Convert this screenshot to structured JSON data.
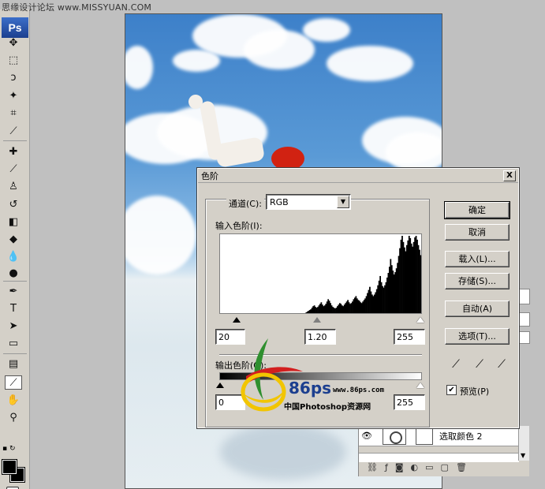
{
  "watermark": "思缘设计论坛 www.MISSYUAN.COM",
  "app": {
    "logo": "Ps"
  },
  "tools": [
    {
      "name": "move-tool-icon",
      "glyph": "✥"
    },
    {
      "name": "marquee-tool-icon",
      "glyph": "⬚"
    },
    {
      "name": "lasso-tool-icon",
      "glyph": "ↄ"
    },
    {
      "name": "magic-wand-tool-icon",
      "glyph": "✦"
    },
    {
      "name": "crop-tool-icon",
      "glyph": "⌗"
    },
    {
      "name": "slice-tool-icon",
      "glyph": "⟋"
    },
    {
      "name": "healing-brush-tool-icon",
      "glyph": "✚"
    },
    {
      "name": "brush-tool-icon",
      "glyph": "⟋"
    },
    {
      "name": "clone-stamp-tool-icon",
      "glyph": "♙"
    },
    {
      "name": "history-brush-tool-icon",
      "glyph": "↺"
    },
    {
      "name": "eraser-tool-icon",
      "glyph": "◧"
    },
    {
      "name": "paint-bucket-tool-icon",
      "glyph": "◆"
    },
    {
      "name": "blur-tool-icon",
      "glyph": "💧"
    },
    {
      "name": "dodge-tool-icon",
      "glyph": "●"
    },
    {
      "name": "pen-tool-icon",
      "glyph": "✒"
    },
    {
      "name": "type-tool-icon",
      "glyph": "T"
    },
    {
      "name": "path-selection-tool-icon",
      "glyph": "➤"
    },
    {
      "name": "shape-tool-icon",
      "glyph": "▭"
    },
    {
      "name": "notes-tool-icon",
      "glyph": "▤"
    },
    {
      "name": "eyedropper-tool-icon",
      "glyph": "⟋"
    },
    {
      "name": "hand-tool-icon",
      "glyph": "✋"
    },
    {
      "name": "zoom-tool-icon",
      "glyph": "⚲"
    }
  ],
  "dialog": {
    "title": "色阶",
    "channel_label": "通道(C):",
    "channel_value": "RGB",
    "input_levels_label": "输入色阶(I):",
    "input_black": "20",
    "input_gamma": "1.20",
    "input_white": "255",
    "output_levels_label": "输出色阶(O):",
    "output_black": "0",
    "output_white": "255",
    "buttons": {
      "ok": "确定",
      "cancel": "取消",
      "load": "载入(L)...",
      "save": "存储(S)...",
      "auto": "自动(A)",
      "options": "选项(T)..."
    },
    "preview_label": "预览(P)",
    "preview_checked": true,
    "close_glyph": "X"
  },
  "layers": {
    "active_layer_name": "选取颜色 2"
  },
  "logo86": {
    "text": "86ps",
    "url": "www.86ps.com",
    "caption": "中国Photoshop资源网"
  },
  "histogram_values": [
    0,
    0,
    0,
    0,
    0,
    0,
    0,
    0,
    0,
    0,
    0,
    0,
    0,
    0,
    0,
    0,
    0,
    0,
    0,
    0,
    0,
    0,
    0,
    0,
    0,
    0,
    0,
    0,
    0,
    0,
    0,
    0,
    0,
    0,
    0,
    0,
    0,
    0,
    0,
    0,
    0,
    0,
    0,
    0,
    0,
    0,
    0,
    0,
    0,
    0,
    0,
    0,
    0,
    0,
    0,
    0,
    0,
    0,
    0,
    0,
    0,
    0,
    0,
    0,
    0,
    0,
    0,
    0,
    0,
    0,
    0,
    0,
    0,
    0,
    1,
    2,
    3,
    4,
    5,
    7,
    9,
    10,
    8,
    7,
    8,
    10,
    12,
    14,
    11,
    9,
    10,
    12,
    15,
    18,
    16,
    13,
    10,
    8,
    7,
    6,
    7,
    9,
    11,
    13,
    12,
    10,
    9,
    11,
    13,
    15,
    17,
    14,
    12,
    13,
    15,
    18,
    20,
    22,
    19,
    17,
    16,
    14,
    13,
    15,
    17,
    19,
    22,
    26,
    30,
    34,
    28,
    24,
    22,
    24,
    27,
    31,
    36,
    42,
    48,
    40,
    35,
    33,
    36,
    40,
    46,
    52,
    60,
    70,
    62,
    55,
    50,
    53,
    58,
    65,
    74,
    84,
    95,
    100,
    92,
    85,
    80,
    88,
    94,
    100,
    97,
    90,
    86,
    92,
    98,
    100,
    95,
    88,
    82,
    75
  ]
}
